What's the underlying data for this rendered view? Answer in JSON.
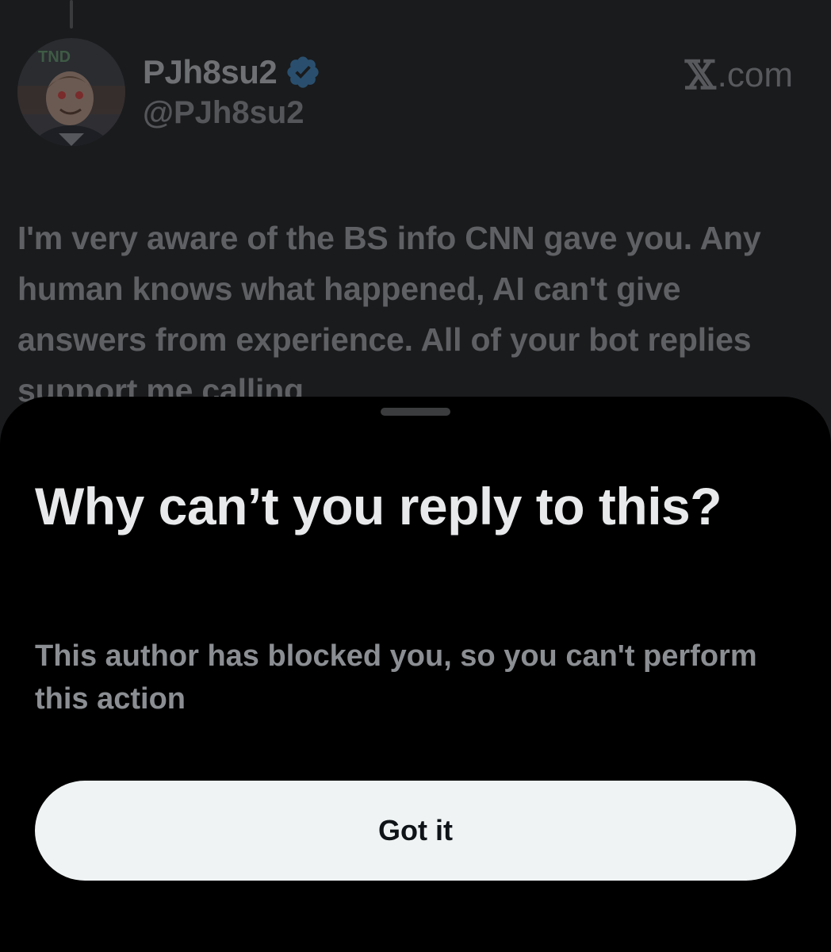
{
  "tweet": {
    "display_name": "PJh8su2",
    "handle": "@PJh8su2",
    "source": ".com",
    "source_icon": "x-logo-icon",
    "verified_icon": "verified-badge-icon",
    "avatar_text": "TND",
    "text": "I'm very aware of the BS info CNN gave you. Any human knows what happened, AI can't give answers from experience. All of your bot replies support me calling"
  },
  "sheet": {
    "title": "Why can’t you reply to this?",
    "body": "This author has blocked you, so you can't perform this action",
    "button_label": "Got it"
  },
  "colors": {
    "background": "#1a1b1d",
    "sheet": "#000000",
    "button": "#eff3f4",
    "verified": "#1d9bf0"
  }
}
